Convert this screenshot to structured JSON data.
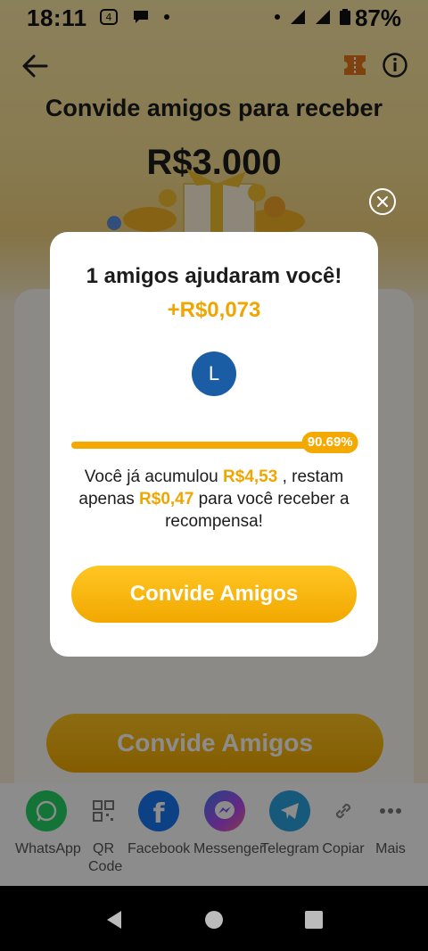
{
  "status_bar": {
    "time": "18:11",
    "battery": "87%"
  },
  "header": {
    "title": "Convide amigos para receber",
    "amount": "R$3.000"
  },
  "background_cta": "Convide Amigos",
  "share": [
    {
      "label": "WhatsApp",
      "icon": "whatsapp-icon",
      "color": "#25d366"
    },
    {
      "label": "QR Code",
      "icon": "qr-code-icon",
      "color": "#ffffff"
    },
    {
      "label": "Facebook",
      "icon": "facebook-icon",
      "color": "#1877f2"
    },
    {
      "label": "Messenger",
      "icon": "messenger-icon",
      "color": "#8b4cf6"
    },
    {
      "label": "Telegram",
      "icon": "telegram-icon",
      "color": "#2aa3e0"
    },
    {
      "label": "Copiar",
      "icon": "link-icon",
      "color": "#ffffff"
    },
    {
      "label": "Mais",
      "icon": "more-icon",
      "color": "#ffffff"
    }
  ],
  "modal": {
    "title": "1 amigos ajudaram você!",
    "amount": "+R$0,073",
    "avatar_initial": "L",
    "progress_value": 0.9069,
    "progress_label": "90.69%",
    "text_1": "Você já acumulou ",
    "accumulated": "R$4,53",
    "text_2": " , restam apenas ",
    "remaining": "R$0,47",
    "text_3": " para você receber a recompensa!",
    "cta": "Convide Amigos"
  },
  "colors": {
    "accent": "#f3a900",
    "avatar": "#1b5da5"
  }
}
